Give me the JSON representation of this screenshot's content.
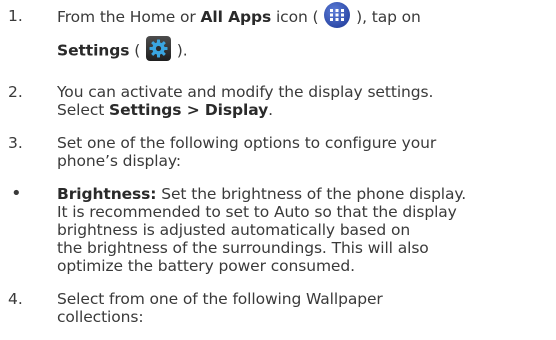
{
  "steps": [
    {
      "number": "1.",
      "line1_pre": "From the Home or ",
      "line1_bold": "All Apps",
      "line1_mid": " icon ( ",
      "line1_post": " ), tap on",
      "line2_bold": "Settings",
      "line2_pre": " ( ",
      "line2_post": " ).",
      "icon1": "all-apps-icon",
      "icon2": "settings-gear-icon"
    },
    {
      "number": "2.",
      "line1": "You can activate and modify the display settings.",
      "line2_pre": "Select ",
      "line2_bold": "Settings > Display",
      "line2_post": "."
    },
    {
      "number": "3.",
      "line1": "Set one of the following options to configure your",
      "line2": "phone’s display:"
    },
    {
      "marker": "•",
      "bold": "Brightness:",
      "line1_rest": " Set the brightness of the phone display.",
      "line2": "It is recommended to set to Auto so that the display",
      "line3": "brightness is adjusted automatically based on",
      "line4": "the brightness of the surroundings. This will also",
      "line5": "optimize the battery power consumed."
    },
    {
      "number": "4.",
      "line1": "Select from one of the following Wallpaper",
      "line2": "collections:"
    }
  ],
  "colors": {
    "text": "#3a3a3a",
    "apps_icon": "#2d4aa8",
    "settings_icon": "#2b2b2b",
    "gear": "#3aa5e0"
  }
}
